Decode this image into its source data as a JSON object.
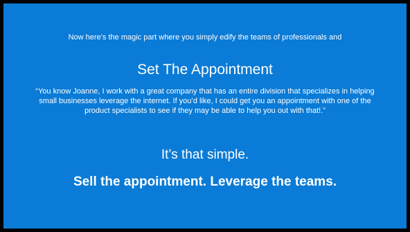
{
  "slide": {
    "intro_text": "Now here’s the magic part where you simply edify the teams of professionals and",
    "heading": "Set The Appointment",
    "quote": "“You know Joanne, I work with a great company that has an entire division that specializes in helping small businesses leverage the internet.  If you’d like, I could get you an appointment with one of the product specialists to see if they may be able to help you out with that!.”",
    "simple_text": "It’s that simple.",
    "tagline": "Sell the appointment.  Leverage the teams."
  },
  "colors": {
    "background": "#0a7bd6",
    "frame": "#000000",
    "text": "#ffffff"
  }
}
